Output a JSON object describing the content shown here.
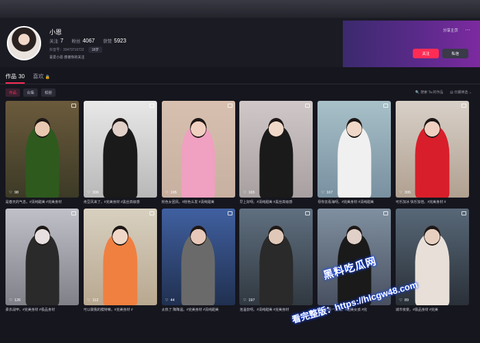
{
  "profile": {
    "name": "小恩",
    "stats": [
      {
        "label": "关注",
        "value": "7"
      },
      {
        "label": "粉丝",
        "value": "4067"
      },
      {
        "label": "获赞",
        "value": "5923"
      }
    ],
    "id_text": "抖音号：33473710722",
    "age_tag": "18岁",
    "bio": "喜爱小恩 感谢你的关注",
    "share_label": "分享主页",
    "more_icon": "…",
    "follow_label": "关注",
    "message_label": "私信"
  },
  "tabs": [
    {
      "label": "作品",
      "count": "30"
    },
    {
      "label": "喜欢",
      "icon": "🔒"
    }
  ],
  "subtabs": [
    "作品",
    "合集",
    "相册"
  ],
  "tools": {
    "search_label": "🔍 搜索 Ta 的作品",
    "date_filter_label": "▤ 日期筛选 ⌄"
  },
  "videos": [
    {
      "likes": "98",
      "caption": "是春天的气息。#清纯甜美 #完美身材"
    },
    {
      "likes": "306",
      "caption": "肯豆风来了。#完美身材 #黑丝高级感"
    },
    {
      "likes": "195",
      "caption": "粉色女团风。#粉色头发 #清纯甜美"
    },
    {
      "likes": "165",
      "caption": "早上好呀。#清纯甜美 #黑丝高级感"
    },
    {
      "likes": "167",
      "caption": "母你去看海呀。#完美身材 #清纯甜美"
    },
    {
      "likes": "305",
      "caption": "可乐加冰 快乐加倍。#完美身材 #"
    },
    {
      "likes": "126",
      "caption": "柔衣战甲。#完美身材 #极品身材"
    },
    {
      "likes": "112",
      "caption": "可以做我的模特嘛。#完美身材 #"
    },
    {
      "likes": "44",
      "caption": "太热了 降降温。#完美身材 #清纯甜美"
    },
    {
      "likes": "197",
      "caption": "泡温泉呀。#清纯甜美 #完美身材"
    },
    {
      "likes": "",
      "caption": "母你去看一次海。#甜美女孩 #完"
    },
    {
      "likes": "89",
      "caption": "城市夜景。#极品身材 #完美"
    }
  ],
  "watermark": {
    "line1": "黑料吃瓜网",
    "line2": "看完整版：https://hlcgw48.com"
  },
  "colors": {
    "accent": "#fe2c55",
    "background": "#16161e"
  }
}
